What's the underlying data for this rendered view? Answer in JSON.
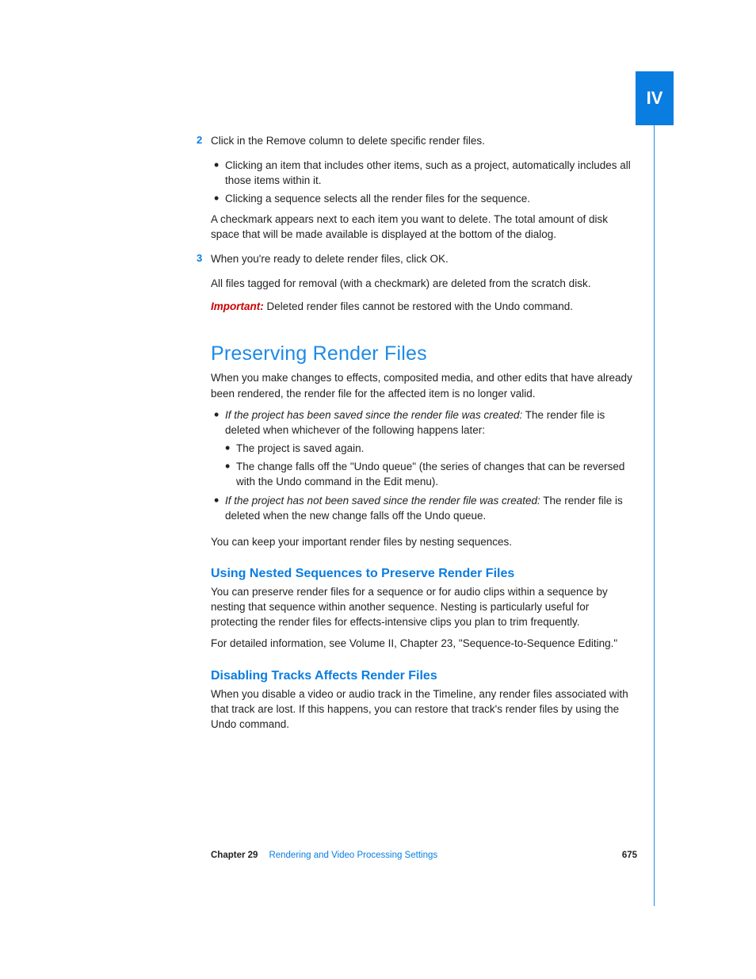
{
  "part_tab": "IV",
  "steps": {
    "s2": {
      "num": "2",
      "text": "Click in the Remove column to delete specific render files.",
      "bullet1": "Clicking an item that includes other items, such as a project, automatically includes all those items within it.",
      "bullet2": "Clicking a sequence selects all the render files for the sequence.",
      "followup": "A checkmark appears next to each item you want to delete. The total amount of disk space that will be made available is displayed at the bottom of the dialog."
    },
    "s3": {
      "num": "3",
      "text": "When you're ready to delete render files, click OK.",
      "followup": "All files tagged for removal (with a checkmark) are deleted from the scratch disk."
    }
  },
  "important_label": "Important:",
  "important_text": " Deleted render files cannot be restored with the Undo command.",
  "heading1": "Preserving Render Files",
  "intro": "When you make changes to effects, composited media, and other edits that have already been rendered, the render file for the affected item is no longer valid.",
  "case1": {
    "leadin": "If the project has been saved since the render file was created:",
    "rest": " The render file is deleted when whichever of the following happens later:",
    "sub1": "The project is saved again.",
    "sub2": "The change falls off the \"Undo queue\" (the series of changes that can be reversed with the Undo command in the Edit menu)."
  },
  "case2": {
    "leadin": "If the project has not been saved since the render file was created:",
    "rest": " The render file is deleted when the new change falls off the Undo queue."
  },
  "nest_note": "You can keep your important render files by nesting sequences.",
  "h2a": "Using Nested Sequences to Preserve Render Files",
  "nested_para": "You can preserve render files for a sequence or for audio clips within a sequence by nesting that sequence within another sequence. Nesting is particularly useful for protecting the render files for effects-intensive clips you plan to trim frequently.",
  "xref": "For detailed information, see Volume II, Chapter 23, \"Sequence-to-Sequence Editing.\"",
  "h2b": "Disabling Tracks Affects Render Files",
  "disable_para": "When you disable a video or audio track in the Timeline, any render files associated with that track are lost. If this happens, you can restore that track's render files by using the Undo command.",
  "footer": {
    "chapter_label": "Chapter 29",
    "chapter_title": "Rendering and Video Processing Settings",
    "page_number": "675"
  }
}
